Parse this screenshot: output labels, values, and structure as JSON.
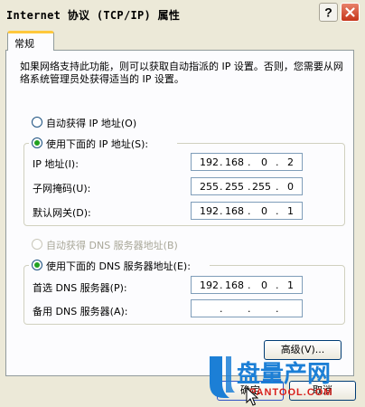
{
  "window": {
    "title": "Internet 协议 (TCP/IP) 属性"
  },
  "tabs": [
    {
      "label": "常规"
    }
  ],
  "description": "如果网络支持此功能，则可以获取自动指派的 IP 设置。否则，您需要从网络系统管理员处获得适当的 IP 设置。",
  "ip_mode": {
    "auto": {
      "label": "自动获得 IP 地址(O)",
      "checked": false
    },
    "manual": {
      "label": "使用下面的 IP 地址(S):",
      "checked": true
    }
  },
  "ip_fields": [
    {
      "label": "IP 地址(I):",
      "octets": [
        "192",
        "168",
        "0",
        "2"
      ]
    },
    {
      "label": "子网掩码(U):",
      "octets": [
        "255",
        "255",
        "255",
        "0"
      ]
    },
    {
      "label": "默认网关(D):",
      "octets": [
        "192",
        "168",
        "0",
        "1"
      ]
    }
  ],
  "dns_mode": {
    "auto": {
      "label": "自动获得 DNS 服务器地址(B)",
      "checked": false,
      "disabled": true
    },
    "manual": {
      "label": "使用下面的 DNS 服务器地址(E):",
      "checked": true
    }
  },
  "dns_fields": [
    {
      "label": "首选 DNS 服务器(P):",
      "octets": [
        "192",
        "168",
        "0",
        "1"
      ]
    },
    {
      "label": "备用 DNS 服务器(A):",
      "octets": [
        "",
        "",
        "",
        ""
      ]
    }
  ],
  "buttons": {
    "advanced": "高级(V)...",
    "ok": "确定",
    "cancel": "取消"
  },
  "watermark": {
    "text": "盘量产网",
    "url": "PANTOOL.COM"
  },
  "colors": {
    "title_bar_bg": "#ece9d8",
    "tab_highlight": "#ffc83c",
    "close_button": "#c53519",
    "radio_dot": "#21a121",
    "watermark_blue": "#1c7fd6",
    "watermark_red": "#d8201b"
  }
}
